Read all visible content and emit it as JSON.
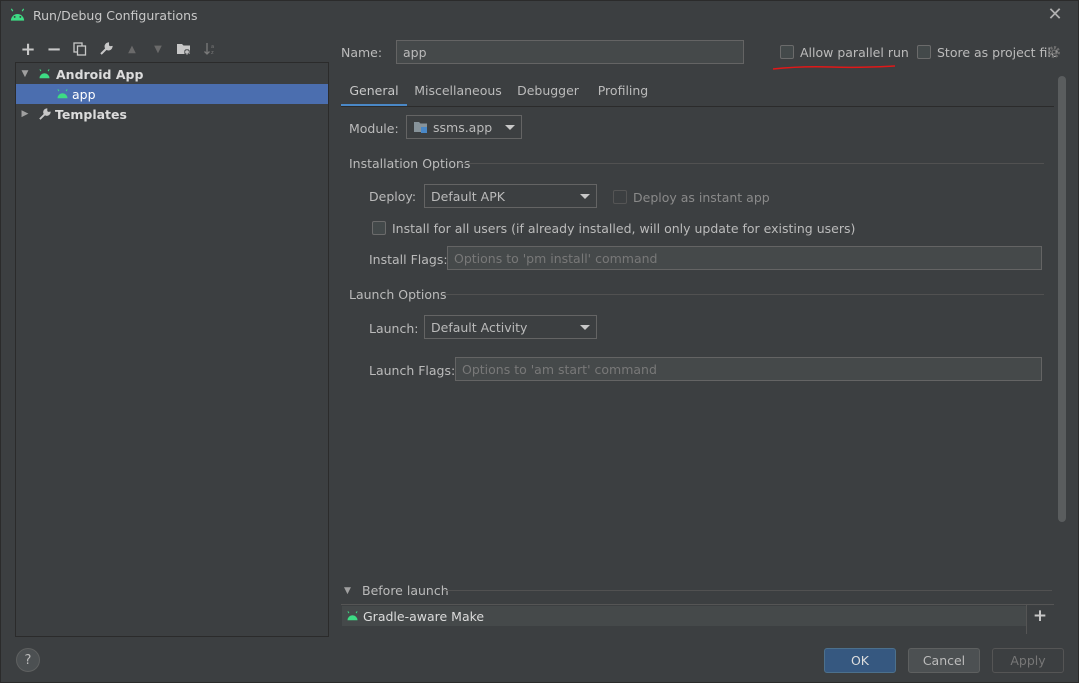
{
  "window": {
    "title": "Run/Debug Configurations"
  },
  "toolbar": {
    "add": "+",
    "remove": "−"
  },
  "tree": {
    "android_app": "Android App",
    "app": "app",
    "templates": "Templates"
  },
  "header": {
    "name_label": "Name:",
    "name_value": "app",
    "allow_parallel": "Allow parallel run",
    "store_project": "Store as project file"
  },
  "tabs": [
    {
      "label": "General"
    },
    {
      "label": "Miscellaneous"
    },
    {
      "label": "Debugger"
    },
    {
      "label": "Profiling"
    }
  ],
  "general": {
    "module_label": "Module:",
    "module_value": "ssms.app",
    "installation_title": "Installation Options",
    "deploy_label": "Deploy:",
    "deploy_value": "Default APK",
    "instant_app": "Deploy as instant app",
    "install_all_users": "Install for all users (if already installed, will only update for existing users)",
    "install_flags_label": "Install Flags:",
    "install_flags_placeholder": "Options to 'pm install' command",
    "launch_title": "Launch Options",
    "launch_label": "Launch:",
    "launch_value": "Default Activity",
    "launch_flags_label": "Launch Flags:",
    "launch_flags_placeholder": "Options to 'am start' command"
  },
  "before_launch": {
    "title": "Before launch",
    "item": "Gradle-aware Make",
    "add": "+"
  },
  "buttons": {
    "help": "?",
    "ok": "OK",
    "cancel": "Cancel",
    "apply": "Apply"
  },
  "colors": {
    "android_green": "#3ddc84",
    "selection": "#4b6eaf",
    "accent_tab": "#4a88c7",
    "annotation_red": "#e01818"
  }
}
